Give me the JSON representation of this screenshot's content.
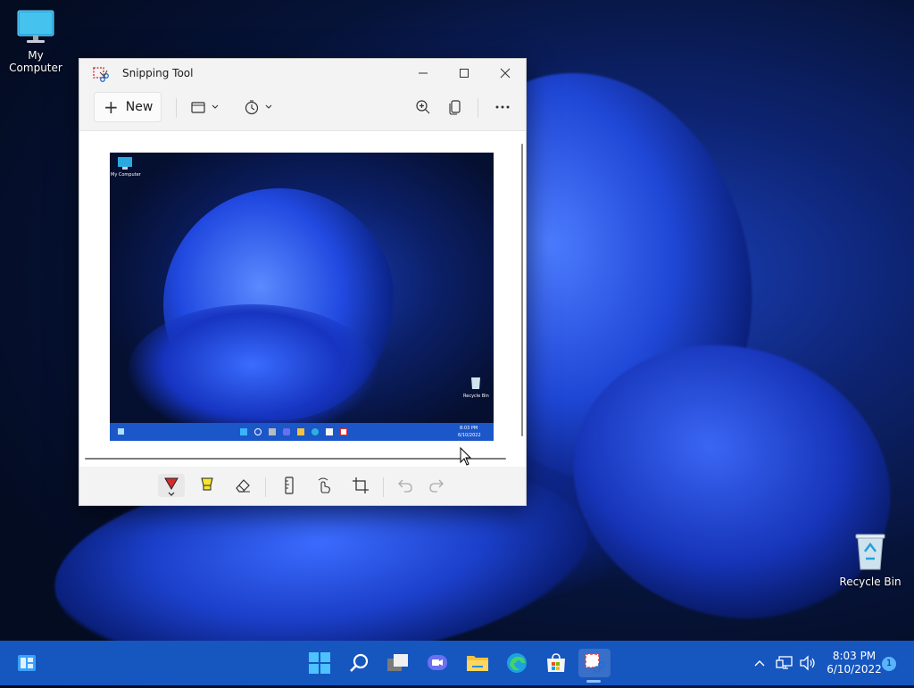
{
  "desktop": {
    "icons": [
      {
        "label": "My Computer",
        "icon": "monitor-icon"
      },
      {
        "label": "Recycle Bin",
        "icon": "recycle-bin-icon"
      }
    ]
  },
  "window": {
    "title": "Snipping Tool",
    "toolbar": {
      "new_label": "New",
      "mode_icon": "rectangle-mode-icon",
      "delay_icon": "timer-icon",
      "zoom_icon": "zoom-in-icon",
      "copy_icon": "copy-icon",
      "more_icon": "more-icon"
    },
    "preview": {
      "my_computer_label": "My Computer",
      "recycle_bin_label": "Recycle Bin",
      "time": "8:03 PM",
      "date": "6/10/2022"
    },
    "markup_tools": [
      "ballpoint-pen-icon",
      "highlighter-icon",
      "eraser-icon",
      "ruler-icon",
      "touch-writing-icon",
      "crop-icon",
      "undo-icon",
      "redo-icon"
    ]
  },
  "taskbar": {
    "icons": [
      "widgets-icon",
      "start-icon",
      "search-icon",
      "task-view-icon",
      "chat-icon",
      "file-explorer-icon",
      "edge-icon",
      "store-icon",
      "snipping-tool-icon"
    ],
    "tray_icons": [
      "chevron-up-icon",
      "network-icon",
      "volume-icon"
    ],
    "time": "8:03 PM",
    "date": "6/10/2022",
    "notification_count": "1"
  },
  "colors": {
    "taskbar": "#1656bf",
    "accent": "#0067c0"
  }
}
